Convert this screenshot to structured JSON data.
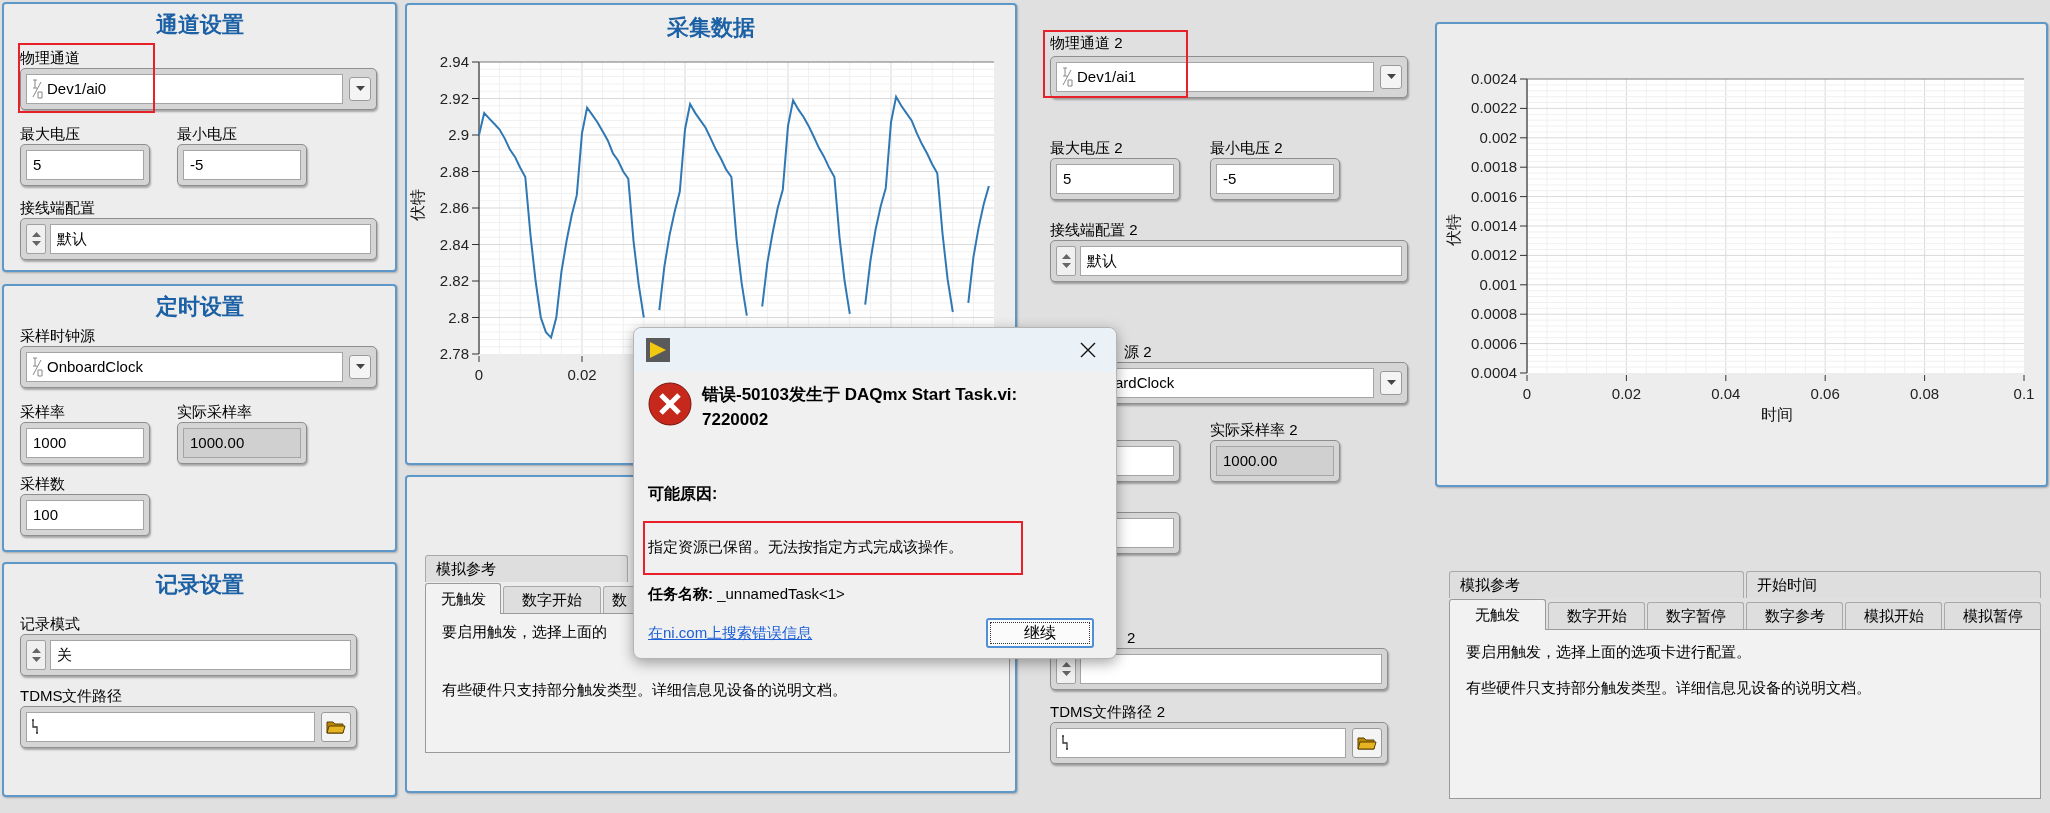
{
  "channel_settings": {
    "title": "通道设置",
    "physical_channel": {
      "label": "物理通道",
      "value": "Dev1/ai0"
    },
    "max_voltage": {
      "label": "最大电压",
      "value": "5"
    },
    "min_voltage": {
      "label": "最小电压",
      "value": "-5"
    },
    "terminal_config": {
      "label": "接线端配置",
      "value": "默认"
    }
  },
  "timing_settings": {
    "title": "定时设置",
    "clock_source": {
      "label": "采样时钟源",
      "value": "OnboardClock"
    },
    "sample_rate": {
      "label": "采样率",
      "value": "1000"
    },
    "actual_rate": {
      "label": "实际采样率",
      "value": "1000.00"
    },
    "samples": {
      "label": "采样数",
      "value": "100"
    }
  },
  "logging_settings": {
    "title": "记录设置",
    "mode": {
      "label": "记录模式",
      "value": "关"
    },
    "tdms_path": {
      "label": "TDMS文件路径"
    }
  },
  "acquired_data": {
    "title": "采集数据",
    "chart_data": {
      "type": "line",
      "grid": true,
      "ylabel": "伏特",
      "xlim": [
        0,
        0.1
      ],
      "ylim": [
        2.78,
        2.94
      ],
      "xticks": [
        0,
        0.02
      ],
      "yticks": [
        2.78,
        2.8,
        2.82,
        2.84,
        2.86,
        2.88,
        2.9,
        2.92,
        2.94
      ],
      "x": [
        0,
        0.001,
        0.002,
        0.003,
        0.004,
        0.005,
        0.006,
        0.007,
        0.008,
        0.009,
        0.01,
        0.011,
        0.012,
        0.013,
        0.014,
        0.015,
        0.016,
        0.017,
        0.018,
        0.019,
        0.02,
        0.021,
        0.022,
        0.023,
        0.024,
        0.025,
        0.026,
        0.027,
        0.028,
        0.029,
        0.03,
        0.031,
        0.032,
        0.033,
        0.034,
        0.035,
        0.036,
        0.037,
        0.038,
        0.039,
        0.04,
        0.041,
        0.042,
        0.043,
        0.044,
        0.045,
        0.046,
        0.047,
        0.048,
        0.049,
        0.05,
        0.051,
        0.052,
        0.053,
        0.054,
        0.055,
        0.056,
        0.057,
        0.058,
        0.059,
        0.06,
        0.061,
        0.062,
        0.063,
        0.064,
        0.065,
        0.066,
        0.067,
        0.068,
        0.069,
        0.07,
        0.071,
        0.072,
        0.073,
        0.074,
        0.075,
        0.076,
        0.077,
        0.078,
        0.079,
        0.08,
        0.081,
        0.082,
        0.083,
        0.084,
        0.085,
        0.086,
        0.087,
        0.088,
        0.089,
        0.09,
        0.091,
        0.092,
        0.093,
        0.094,
        0.095,
        0.096,
        0.097,
        0.098,
        0.099
      ],
      "series": [
        {
          "color": "#2f78b4",
          "values": [
            2.9,
            2.912,
            2.909,
            2.906,
            2.903,
            2.898,
            2.892,
            2.888,
            2.882,
            2.877,
            2.845,
            2.82,
            2.8,
            2.792,
            2.789,
            2.8,
            2.825,
            2.842,
            2.856,
            2.867,
            2.901,
            2.915,
            2.911,
            2.907,
            2.902,
            2.897,
            2.89,
            2.886,
            2.88,
            2.876,
            2.842,
            2.818,
            2.8,
            null,
            null,
            2.804,
            2.828,
            2.845,
            2.858,
            2.869,
            2.903,
            2.917,
            2.912,
            2.908,
            2.904,
            2.898,
            2.892,
            2.887,
            2.881,
            2.877,
            2.843,
            2.819,
            2.801,
            null,
            null,
            2.806,
            2.83,
            2.846,
            2.86,
            2.87,
            2.905,
            2.919,
            2.914,
            2.91,
            2.905,
            2.899,
            2.893,
            2.888,
            2.882,
            2.877,
            2.844,
            2.82,
            2.802,
            null,
            null,
            2.807,
            2.831,
            2.848,
            2.861,
            2.871,
            2.907,
            2.921,
            2.916,
            2.912,
            2.908,
            2.901,
            2.895,
            2.89,
            2.884,
            2.879,
            2.846,
            2.821,
            2.803,
            null,
            null,
            2.808,
            2.833,
            2.849,
            2.862,
            2.872
          ]
        }
      ]
    }
  },
  "trigger_tabs_1": {
    "back_tabs": [
      {
        "label": "模拟参考",
        "selected": false
      }
    ],
    "tabs": [
      {
        "label": "无触发",
        "selected": true
      },
      {
        "label": "数字开始",
        "selected": false
      },
      {
        "label": "数",
        "selected": false
      }
    ],
    "lines": [
      "要启用触发，选择上面的",
      "有些硬件只支持部分触发类型。详细信息见设备的说明文档。"
    ]
  },
  "channel_2": {
    "physical_channel": {
      "label": "物理通道 2",
      "value": "Dev1/ai1"
    },
    "max_voltage": {
      "label": "最大电压 2",
      "value": "5"
    },
    "min_voltage": {
      "label": "最小电压 2",
      "value": "-5"
    },
    "terminal_config": {
      "label": "接线端配置 2",
      "value": "默认"
    },
    "clock_source": {
      "label": "源 2",
      "value": "ardClock"
    },
    "actual_rate": {
      "label": "实际采样率 2",
      "value": "1000.00"
    },
    "logging_mode": {
      "label": "2"
    },
    "tdms_path": {
      "label": "TDMS文件路径 2"
    }
  },
  "chart_2": {
    "chart_data": {
      "type": "line",
      "grid": true,
      "xlabel": "时间",
      "ylabel": "伏特",
      "xlim": [
        0,
        0.1
      ],
      "ylim": [
        0.0004,
        0.0024
      ],
      "xticks": [
        0,
        0.02,
        0.04,
        0.06,
        0.08,
        0.1
      ],
      "yticks": [
        0.0004,
        0.0006,
        0.0008,
        0.001,
        0.0012,
        0.0014,
        0.0016,
        0.0018,
        0.002,
        0.0022,
        0.0024
      ]
    }
  },
  "trigger_tabs_2": {
    "back_tabs": [
      {
        "label": "模拟参考",
        "selected": false
      },
      {
        "label": "开始时间",
        "selected": false
      }
    ],
    "tabs": [
      {
        "label": "无触发",
        "selected": true
      },
      {
        "label": "数字开始",
        "selected": false
      },
      {
        "label": "数字暂停",
        "selected": false
      },
      {
        "label": "数字参考",
        "selected": false
      },
      {
        "label": "模拟开始",
        "selected": false
      },
      {
        "label": "模拟暂停",
        "selected": false
      }
    ],
    "lines": [
      "要启用触发，选择上面的选项卡进行配置。",
      "有些硬件只支持部分触发类型。详细信息见设备的说明文档。"
    ]
  },
  "error_dialog": {
    "heading_lines": [
      "错误-50103发生于 DAQmx Start Task.vi:",
      "7220002"
    ],
    "cause_label": "可能原因:",
    "cause": "指定资源已保留。无法按指定方式完成该操作。",
    "task": "**任务名称:** _unnamedTask<1>",
    "link": "在ni.com上搜索错误信息",
    "button": "继续"
  }
}
